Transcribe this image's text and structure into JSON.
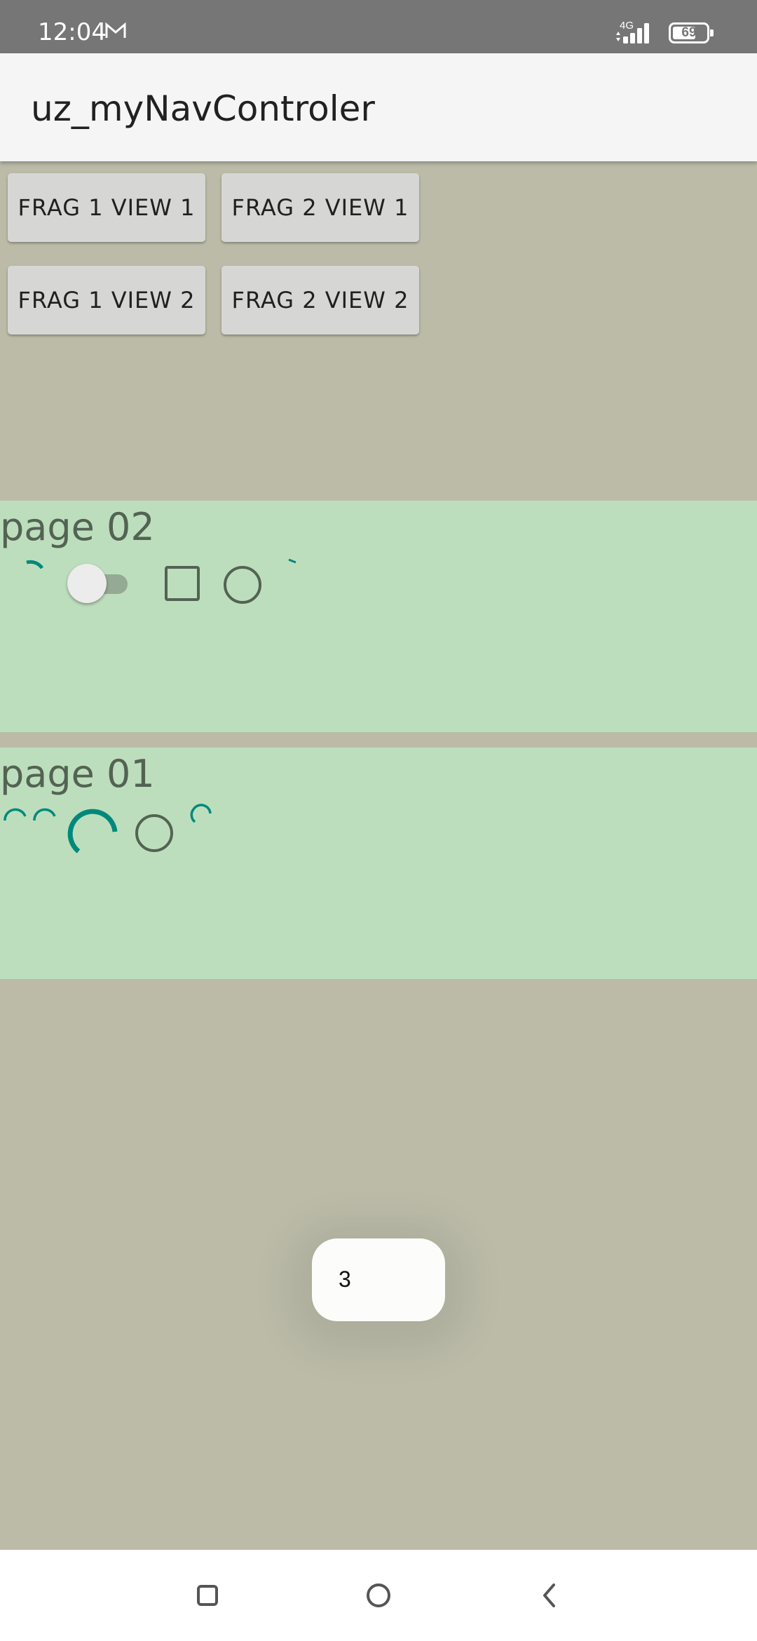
{
  "status_bar": {
    "time": "12:04",
    "network": "4G",
    "battery": "69",
    "battery_level": 0.69
  },
  "app_bar": {
    "title": "uz_myNavControler"
  },
  "buttons": {
    "frag1_view1": "FRAG 1 VIEW 1",
    "frag2_view1": "FRAG 2 VIEW 1",
    "frag1_view2": "FRAG 1 VIEW 2",
    "frag2_view2": "FRAG 2 VIEW 2"
  },
  "page02": {
    "title": "page 02"
  },
  "page01": {
    "title": "page 01"
  },
  "toast": {
    "text": "3"
  },
  "colors": {
    "background": "#bbbba8",
    "page_background": "#bddebd",
    "accent": "#00897b",
    "icon_stroke": "#536353"
  }
}
